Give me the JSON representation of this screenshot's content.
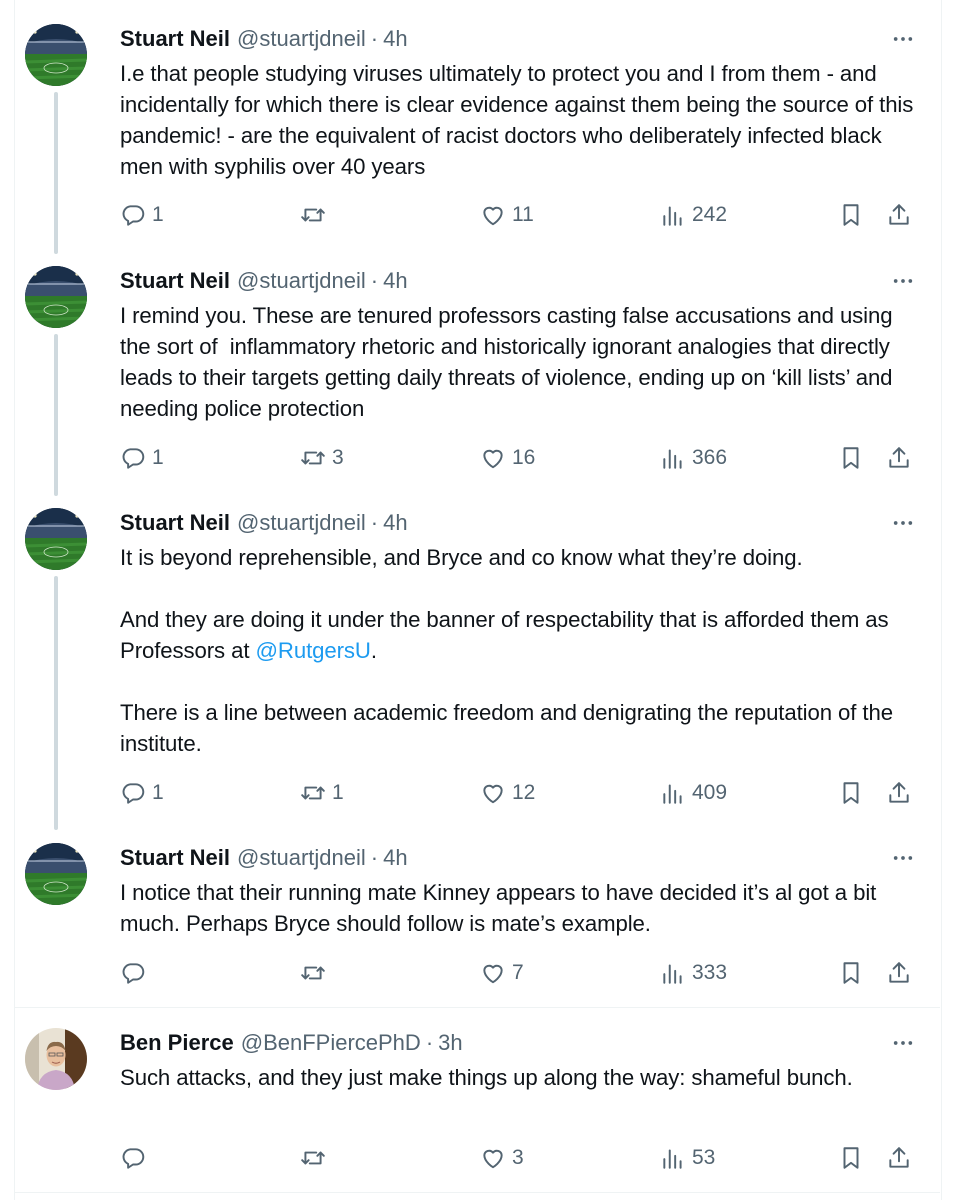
{
  "colors": {
    "text": "#0f1419",
    "secondary": "#536471",
    "link": "#1d9bf0",
    "thread_line": "#cfd9de"
  },
  "tweets": [
    {
      "name": "Stuart Neil",
      "handle": "@stuartjdneil",
      "separator": "·",
      "time": "4h",
      "avatar": "stadium-avatar",
      "text": "I.e that people studying viruses ultimately to protect you and I from them - and incidentally for which there is clear evidence against them being the source of this pandemic! - are the equivalent of racist doctors who deliberately infected black men with syphilis over 40 years",
      "replies": "1",
      "retweets": "",
      "likes": "11",
      "views": "242"
    },
    {
      "name": "Stuart Neil",
      "handle": "@stuartjdneil",
      "separator": "·",
      "time": "4h",
      "avatar": "stadium-avatar",
      "text": "I remind you. These are tenured professors casting false accusations and using the sort of  inflammatory rhetoric and historically ignorant analogies that directly leads to their targets getting daily threats of violence, ending up on ‘kill lists’ and needing police protection",
      "replies": "1",
      "retweets": "3",
      "likes": "16",
      "views": "366"
    },
    {
      "name": "Stuart Neil",
      "handle": "@stuartjdneil",
      "separator": "·",
      "time": "4h",
      "avatar": "stadium-avatar",
      "text_before": "It is beyond reprehensible, and Bryce and co know what they’re doing.\n\nAnd they are doing it under the banner of respectability that is afforded them as Professors at ",
      "mention": "@RutgersU",
      "text_after": ".\n\nThere is a line between academic freedom and denigrating the reputation of the institute.",
      "replies": "1",
      "retweets": "1",
      "likes": "12",
      "views": "409"
    },
    {
      "name": "Stuart Neil",
      "handle": "@stuartjdneil",
      "separator": "·",
      "time": "4h",
      "avatar": "stadium-avatar",
      "text": "I notice that their running mate Kinney appears to have decided it’s al got a bit much. Perhaps Bryce should follow is mate’s example.",
      "replies": "",
      "retweets": "",
      "likes": "7",
      "views": "333"
    },
    {
      "name": "Ben Pierce",
      "handle": "@BenFPiercePhD",
      "separator": "·",
      "time": "3h",
      "avatar": "person-avatar",
      "text": "Such attacks, and they just make things up along the way: shameful bunch.",
      "replies": "",
      "retweets": "",
      "likes": "3",
      "views": "53"
    }
  ]
}
